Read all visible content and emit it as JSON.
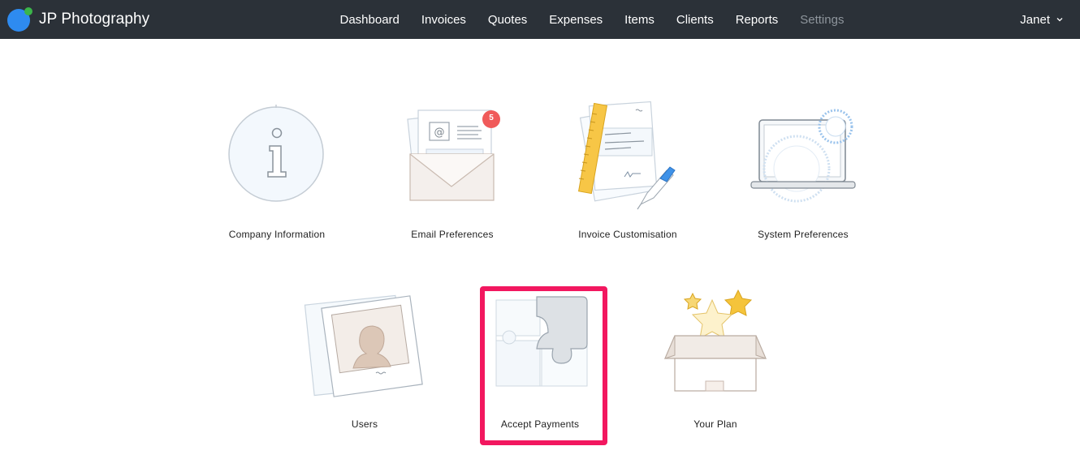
{
  "header": {
    "brand_name": "JP Photography",
    "nav": [
      {
        "label": "Dashboard",
        "active": false
      },
      {
        "label": "Invoices",
        "active": false
      },
      {
        "label": "Quotes",
        "active": false
      },
      {
        "label": "Expenses",
        "active": false
      },
      {
        "label": "Items",
        "active": false
      },
      {
        "label": "Clients",
        "active": false
      },
      {
        "label": "Reports",
        "active": false
      },
      {
        "label": "Settings",
        "active": true
      }
    ],
    "user_name": "Janet"
  },
  "settings": {
    "company_information": "Company Information",
    "email_preferences": "Email Preferences",
    "email_badge_count": "5",
    "invoice_customisation": "Invoice Customisation",
    "system_preferences": "System Preferences",
    "users": "Users",
    "accept_payments": "Accept Payments",
    "your_plan": "Your Plan"
  },
  "colors": {
    "topbar": "#2b3138",
    "highlight": "#f2175f",
    "badge": "#f05a5a",
    "nav_inactive": "#8e959c"
  }
}
